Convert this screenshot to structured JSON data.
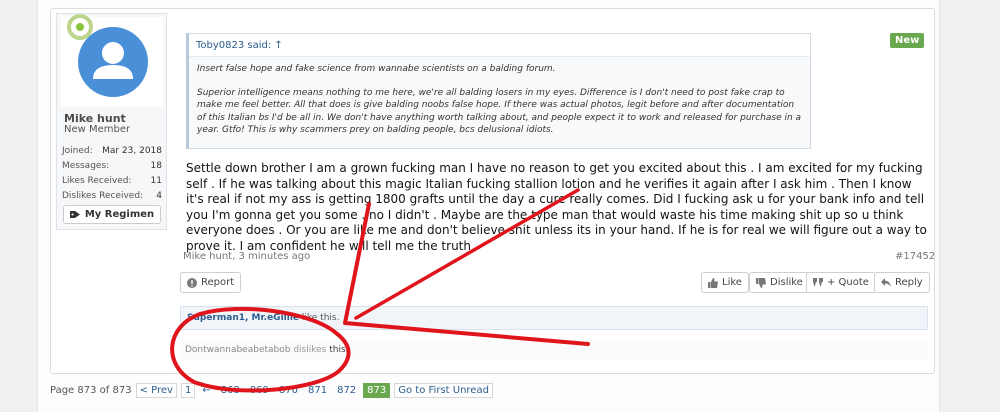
{
  "user": {
    "name": "Mike hunt",
    "title": "New Member",
    "stats": [
      {
        "label": "Joined:",
        "value": "Mar 23, 2018"
      },
      {
        "label": "Messages:",
        "value": "18"
      },
      {
        "label": "Likes Received:",
        "value": "11"
      },
      {
        "label": "Dislikes Received:",
        "value": "4"
      }
    ],
    "regimen_label": "My Regimen"
  },
  "quote": {
    "header": "Toby0823 said: ↑",
    "p1": "Insert false hope and fake science from wannabe scientists on a balding forum.",
    "p2": "Superior intelligence means nothing to me here, we're all balding losers in my eyes. Difference is I don't need to post fake crap to make me feel better. All that does is give balding noobs false hope. If there was actual photos, legit before and after documentation of this Italian bs I'd be all in. We don't have anything worth talking about, and people expect it to work and released for purchase in a year. Gtfo! This is why scammers prey on balding people, bcs delusional idiots."
  },
  "badge": "New",
  "message": "Settle down brother I am a grown fucking man I have no reason to get you excited about this . I am excited for my fucking self . If he was talking about this magic Italian fucking stallion lotion and he verifies it again after I ask him . Then I know it's real if not my ass is getting 1800 grafts until the day a cure really comes. Did I fucking ask u for your bank info and tell you I'm gonna get you some ..no I didn't . Maybe are the type man that would waste his time making shit up so u think everyone does . Or you are like me and don't believe shit unless its in your hand. If he is for real we will figure out a way to prove it. I am confident he will tell me the truth",
  "meta": {
    "author_time": "Mike hunt, 3 minutes ago",
    "post_number": "#17452"
  },
  "buttons": {
    "report": "Report",
    "like": "Like",
    "dislike": "Dislike",
    "quote": "+ Quote",
    "reply": "Reply"
  },
  "likes": {
    "users": "Superman1, Mr.eGillie",
    "suffix": "like this."
  },
  "dislikes": {
    "user": "Dontwannabeabetabob",
    "middle": "dislikes",
    "target": "this."
  },
  "pagination": {
    "page_of": "Page 873 of 873",
    "prev": "< Prev",
    "first": "1",
    "arrow": "←",
    "pages": [
      "868",
      "869",
      "870",
      "871",
      "872"
    ],
    "current": "873",
    "first_unread": "Go to First Unread"
  },
  "colors": {
    "accent": "#6aa84f",
    "link": "#2b5d8e",
    "annotation": "#e0141b"
  }
}
